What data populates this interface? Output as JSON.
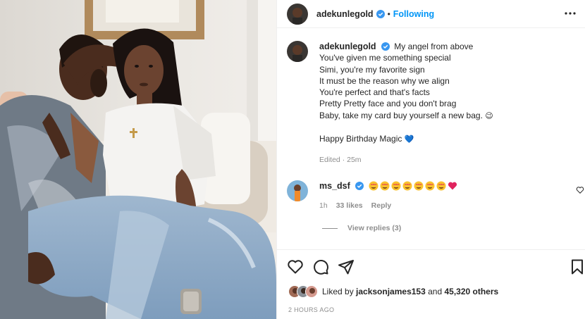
{
  "post": {
    "username": "adekunlegold",
    "follow_label": "Following",
    "separator": "•",
    "caption_lines": [
      "My angel from above",
      "You've given me something special",
      "Simi, you're my favorite sign",
      "It must be the reason why we align",
      "You're perfect and that's facts",
      "Pretty Pretty face and you don't brag",
      "Baby, take my card buy yourself a new bag."
    ],
    "caption_emoji": "😉",
    "birthday_line": "Happy Birthday Magic",
    "birthday_emoji": "💙",
    "edited_meta": "Edited · 25m"
  },
  "comment": {
    "username": "ms_dsf",
    "emoji_count": 7,
    "end_emoji": "heart",
    "time": "1h",
    "likes": "33 likes",
    "reply_label": "Reply",
    "view_replies": "View replies (3)"
  },
  "likes": {
    "prefix": "Liked by ",
    "user": "jacksonjames153",
    "middle": " and ",
    "count": "45,320 others"
  },
  "timestamp": "2 HOURS AGO",
  "colors": {
    "link_blue": "#0095f6",
    "verified_blue": "#3897f0",
    "muted_text": "#8e8e8e",
    "text": "#262626",
    "heart_red": "#ed4956"
  },
  "icons": {
    "more": "more-dots-icon",
    "like": "heart-outline-icon",
    "comment": "comment-bubble-icon",
    "share": "paper-plane-icon",
    "save": "bookmark-icon",
    "verified": "verified-badge-icon"
  }
}
